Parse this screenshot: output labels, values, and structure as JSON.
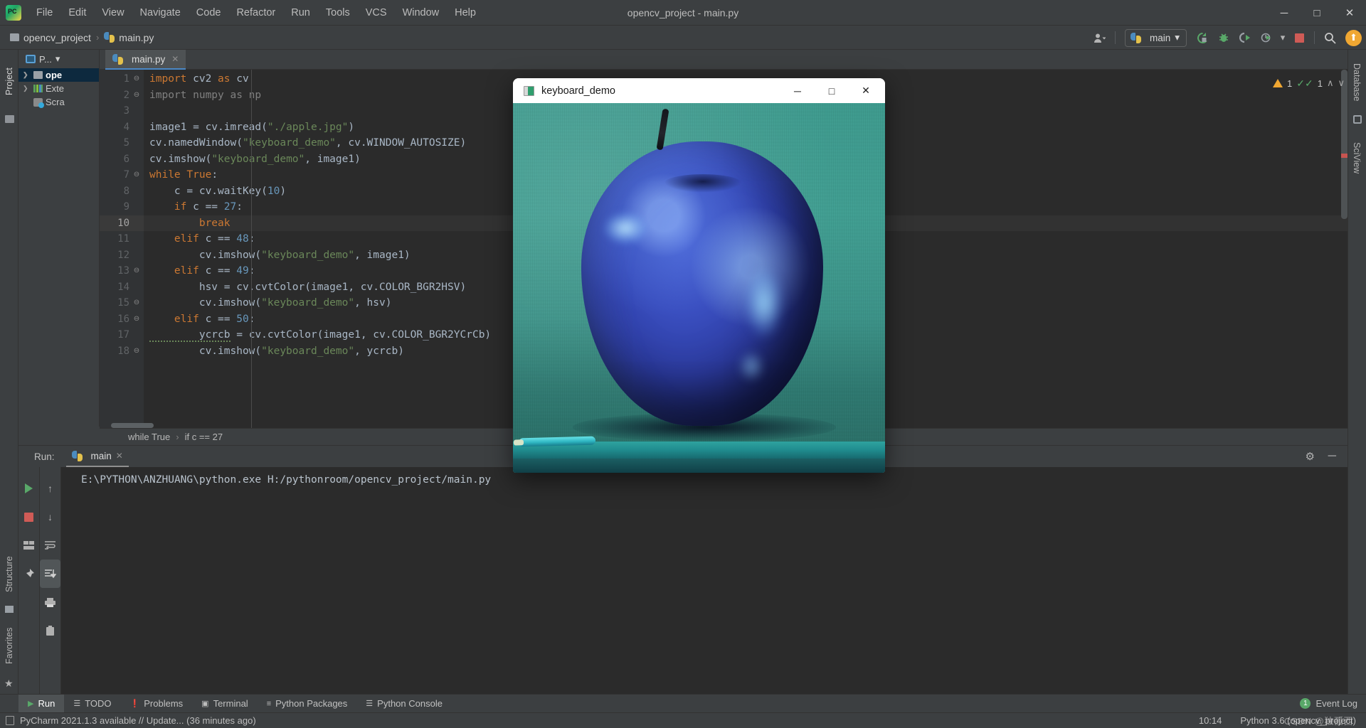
{
  "window": {
    "title": "opencv_project - main.py",
    "minimize": "─",
    "maximize": "□",
    "close": "✕"
  },
  "menubar": {
    "logo": "pycharm-logo",
    "items": [
      "File",
      "Edit",
      "View",
      "Navigate",
      "Code",
      "Refactor",
      "Run",
      "Tools",
      "VCS",
      "Window",
      "Help"
    ]
  },
  "breadcrumb": {
    "project": "opencv_project",
    "separator": "›",
    "file": "main.py"
  },
  "toolbar": {
    "account_caret": "▾",
    "run_config": "main",
    "run_config_caret": "▾",
    "rerun_icon": "rerun-icon",
    "debug_icon": "debug-icon",
    "coverage_icon": "run-with-coverage-icon",
    "profile_icon": "profile-icon",
    "profile_caret": "▾",
    "stop_icon": "stop-icon",
    "search_icon": "🔍",
    "update_icon": "⬆"
  },
  "left_strip": {
    "project_tab": "Project",
    "structure_tab": "Structure",
    "favorites_tab": "Favorites"
  },
  "right_strip": {
    "database_tab": "Database",
    "sciview_tab": "SciView"
  },
  "project_panel": {
    "header": "P...",
    "header_caret": "▾",
    "tree": [
      {
        "label": "ope",
        "arrow": "❯",
        "icon": "folder-icon",
        "selected": true
      },
      {
        "label": "Exte",
        "arrow": "❯",
        "icon": "library-icon",
        "selected": false
      },
      {
        "label": "Scra",
        "arrow": "",
        "icon": "scratch-icon",
        "selected": false
      }
    ]
  },
  "editor": {
    "tab": {
      "label": "main.py",
      "close": "✕"
    },
    "inspection": {
      "warning_count": "1",
      "ok_count": "1",
      "up": "∧",
      "down": "∨"
    },
    "breadcrumb": [
      "while True",
      "if c == 27"
    ],
    "breadcrumb_sep": "›",
    "current_line": 10,
    "lines": [
      {
        "n": 1,
        "fold": "⊖",
        "tokens": [
          [
            "kw",
            "import"
          ],
          [
            "txt",
            " cv2 "
          ],
          [
            "kw",
            "as"
          ],
          [
            "txt",
            " cv"
          ]
        ]
      },
      {
        "n": 2,
        "fold": "⊖",
        "tokens": [
          [
            "dim",
            "import numpy as np"
          ]
        ]
      },
      {
        "n": 3,
        "fold": "",
        "tokens": []
      },
      {
        "n": 4,
        "fold": "",
        "tokens": [
          [
            "txt",
            "image1 = cv.imread("
          ],
          [
            "str",
            "\"./apple.jpg\""
          ],
          [
            "txt",
            ")"
          ]
        ]
      },
      {
        "n": 5,
        "fold": "",
        "tokens": [
          [
            "txt",
            "cv.namedWindow("
          ],
          [
            "str",
            "\"keyboard_demo\""
          ],
          [
            "txt",
            ", cv.WINDOW_AUTOSIZE)"
          ]
        ]
      },
      {
        "n": 6,
        "fold": "",
        "tokens": [
          [
            "txt",
            "cv.imshow("
          ],
          [
            "str",
            "\"keyboard_demo\""
          ],
          [
            "txt",
            ", image1)"
          ]
        ]
      },
      {
        "n": 7,
        "fold": "⊖",
        "tokens": [
          [
            "kw",
            "while True"
          ],
          [
            "txt",
            ":"
          ]
        ]
      },
      {
        "n": 8,
        "fold": "",
        "tokens": [
          [
            "txt",
            "    c = cv.waitKey("
          ],
          [
            "num",
            "10"
          ],
          [
            "txt",
            ")"
          ]
        ]
      },
      {
        "n": 9,
        "fold": "",
        "tokens": [
          [
            "kw",
            "    if"
          ],
          [
            "txt",
            " c == "
          ],
          [
            "num",
            "27"
          ],
          [
            "txt",
            ":"
          ]
        ]
      },
      {
        "n": 10,
        "fold": "",
        "tokens": [
          [
            "kw",
            "        break"
          ]
        ]
      },
      {
        "n": 11,
        "fold": "",
        "tokens": [
          [
            "kw",
            "    elif"
          ],
          [
            "txt",
            " c == "
          ],
          [
            "num",
            "48"
          ],
          [
            "txt",
            ":"
          ]
        ]
      },
      {
        "n": 12,
        "fold": "",
        "tokens": [
          [
            "txt",
            "        cv.imshow("
          ],
          [
            "str",
            "\"keyboard_demo\""
          ],
          [
            "txt",
            ", image1)"
          ]
        ]
      },
      {
        "n": 13,
        "fold": "⊖",
        "tokens": [
          [
            "kw",
            "    elif"
          ],
          [
            "txt",
            " c == "
          ],
          [
            "num",
            "49"
          ],
          [
            "txt",
            ":"
          ]
        ]
      },
      {
        "n": 14,
        "fold": "",
        "tokens": [
          [
            "txt",
            "        hsv = cv.cvtColor(image1, cv.COLOR_BGR2HSV)"
          ]
        ]
      },
      {
        "n": 15,
        "fold": "⊖",
        "tokens": [
          [
            "txt",
            "        cv.imshow("
          ],
          [
            "str",
            "\"keyboard_demo\""
          ],
          [
            "txt",
            ", hsv)"
          ]
        ]
      },
      {
        "n": 16,
        "fold": "⊖",
        "tokens": [
          [
            "kw",
            "    elif"
          ],
          [
            "txt",
            " c == "
          ],
          [
            "num",
            "50"
          ],
          [
            "txt",
            ":"
          ]
        ]
      },
      {
        "n": 17,
        "fold": "",
        "tokens": [
          [
            "err",
            "        ycrcb"
          ],
          [
            "txt",
            " = cv.cvtColor(image1, cv.COLOR_BGR2YCrCb)"
          ]
        ]
      },
      {
        "n": 18,
        "fold": "⊖",
        "tokens": [
          [
            "txt",
            "        cv.imshow("
          ],
          [
            "str",
            "\"keyboard_demo\""
          ],
          [
            "txt",
            ", ycrcb)"
          ]
        ]
      }
    ]
  },
  "run_panel": {
    "label": "Run:",
    "tab": "main",
    "tab_close": "✕",
    "settings_icon": "⚙",
    "hide_icon": "─",
    "console_output": "E:\\PYTHON\\ANZHUANG\\python.exe H:/pythonroom/opencv_project/main.py",
    "left_buttons": [
      "rerun-icon",
      "stop-icon",
      "layout-icon",
      "pin-icon"
    ],
    "second_buttons": [
      "up-arrow-icon",
      "down-arrow-icon",
      "soft-wrap-icon",
      "scroll-to-end-icon",
      "print-icon",
      "trash-icon"
    ]
  },
  "bottom_bar": {
    "items": [
      {
        "label": "Run",
        "icon": "run-icon",
        "active": true
      },
      {
        "label": "TODO",
        "icon": "todo-icon",
        "active": false
      },
      {
        "label": "Problems",
        "icon": "problems-icon",
        "active": false
      },
      {
        "label": "Terminal",
        "icon": "terminal-icon",
        "active": false
      },
      {
        "label": "Python Packages",
        "icon": "packages-icon",
        "active": false
      },
      {
        "label": "Python Console",
        "icon": "python-console-icon",
        "active": false
      }
    ],
    "event_log": {
      "count": "1",
      "label": "Event Log"
    }
  },
  "status_bar": {
    "message": "PyCharm 2021.1.3 available // Update... (36 minutes ago)",
    "time": "10:14",
    "interpreter": "Python 3.6 (opencv_project)"
  },
  "cv_window": {
    "title": "keyboard_demo",
    "minimize": "─",
    "maximize": "□",
    "close": "✕",
    "image_alt": "blue-apple-photo"
  },
  "watermark": "CSDN @独孤西"
}
